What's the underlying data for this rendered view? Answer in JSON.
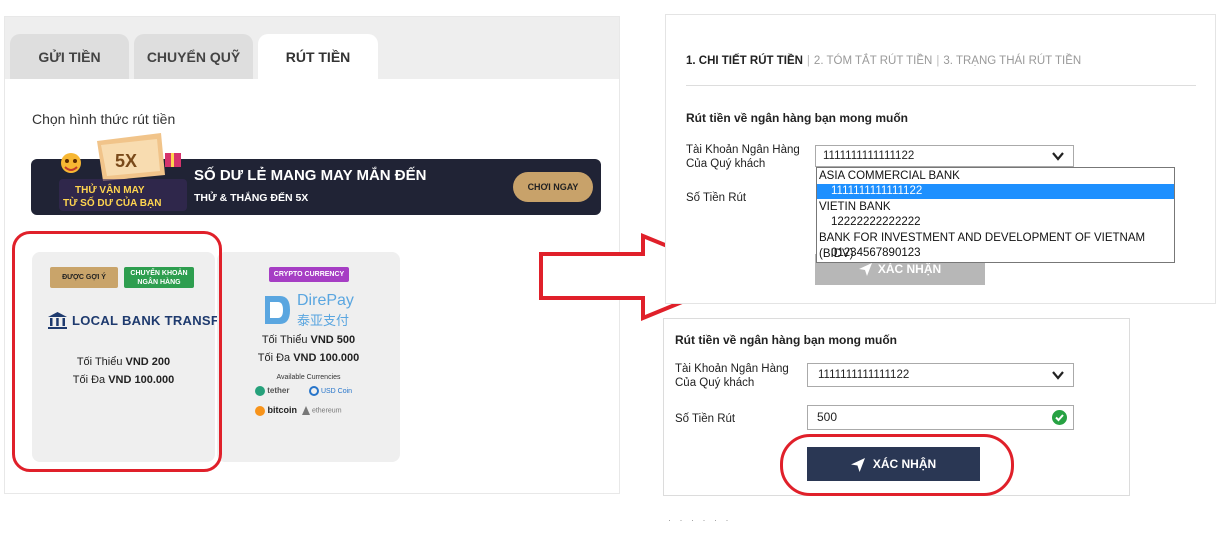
{
  "left": {
    "tabs": [
      {
        "label": "GỬI TIỀN",
        "active": false
      },
      {
        "label": "CHUYỂN QUỸ",
        "active": false
      },
      {
        "label": "RÚT TIỀN",
        "active": true
      }
    ],
    "section_title": "Chọn hình thức rút tiền",
    "banner": {
      "badge": "5X",
      "img_line1": "THỬ VẬN MAY",
      "img_line2": "TỪ SỐ DƯ CỦA BẠN",
      "title": "SỐ DƯ LẺ MANG MAY MẮN ĐẾN",
      "subtitle": "THỬ & THẮNG ĐẾN 5X",
      "button": "CHƠI NGAY"
    },
    "cards": [
      {
        "badge_recommended": "ĐƯỢC GỢI Ý",
        "badge_transfer_1": "CHUYỂN KHOẢN",
        "badge_transfer_2": "NGÂN HÀNG",
        "name": "LOCAL BANK TRANSFER",
        "min_label": "Tối Thiểu",
        "min_value": "VND 200",
        "max_label": "Tối Đa",
        "max_value": "VND 100.000"
      },
      {
        "badge_crypto": "CRYPTO CURRENCY",
        "logo_text": "DirePay",
        "logo_cn": "泰亚支付",
        "min_label": "Tối Thiểu",
        "min_value": "VND 500",
        "max_label": "Tối Đa",
        "max_value": "VND 100.000",
        "available": "Available Currencies",
        "currencies": [
          "tether",
          "USD Coin",
          "bitcoin",
          "ethereum"
        ]
      }
    ]
  },
  "right_top": {
    "steps": [
      "1. CHI TIẾT RÚT TIỀN",
      "2. TÓM TẮT RÚT TIỀN",
      "3. TRẠNG THÁI RÚT TIỀN"
    ],
    "heading": "Rút tiền về ngân hàng bạn mong muốn",
    "account_label_1": "Tài Khoản Ngân Hàng",
    "account_label_2": "Của Quý khách",
    "account_value": "1111111111111122",
    "amount_label": "Số Tiền Rút",
    "dropdown": [
      {
        "group": "ASIA COMMERCIAL BANK",
        "option": "1111111111111122",
        "selected": true
      },
      {
        "group": "VIETIN BANK",
        "option": "12222222222222",
        "selected": false
      },
      {
        "group": "BANK FOR INVESTMENT AND DEVELOPMENT OF VIETNAM (BIDV)",
        "option": "01234567890123",
        "selected": false
      }
    ],
    "confirm": "XÁC NHẬN"
  },
  "right_bottom": {
    "heading": "Rút tiền về ngân hàng bạn mong muốn",
    "account_label_1": "Tài Khoản Ngân Hàng",
    "account_label_2": "Của Quý khách",
    "account_value": "1111111111111122",
    "amount_label": "Số Tiền Rút",
    "amount_value": "500",
    "confirm": "XÁC NHẬN"
  },
  "colors": {
    "highlight": "#e0202a",
    "confirm_bg": "#2a3754",
    "banner_bg": "#202335",
    "crypto_badge": "#a63ec4",
    "recommended_badge": "#c9a46a",
    "transfer_badge": "#2e9e4f"
  }
}
